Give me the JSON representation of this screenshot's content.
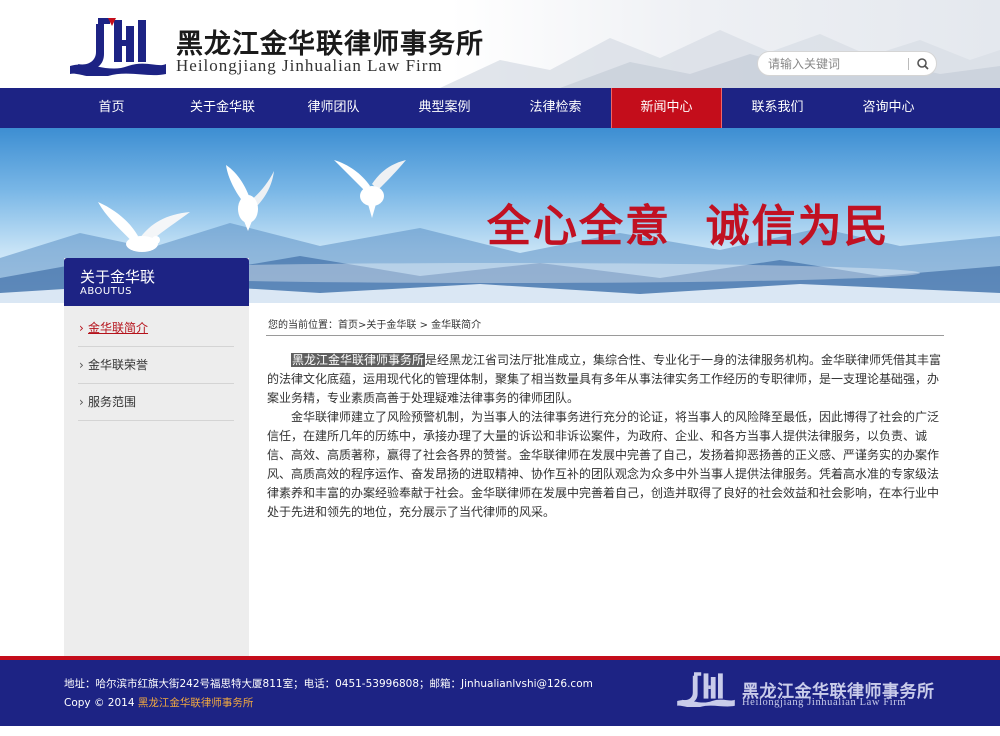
{
  "header": {
    "brand_cn": "黑龙江金华联律师事务所",
    "brand_en": "Heilongjiang Jinhualian Law Firm",
    "search_placeholder": "请输入关键词"
  },
  "nav": {
    "items": [
      "首页",
      "关于金华联",
      "律师团队",
      "典型案例",
      "法律检索",
      "新闻中心",
      "联系我们",
      "咨询中心"
    ],
    "active": "新闻中心"
  },
  "banner": {
    "slogan": "全心全意  诚信为民"
  },
  "sidebar": {
    "title_cn": "关于金华联",
    "title_en": "ABOUTUS",
    "items": [
      "金华联简介",
      "金华联荣誉",
      "服务范围"
    ],
    "active": "金华联简介"
  },
  "breadcrumb": {
    "prefix": "您的当前位置：",
    "items": [
      "首页",
      "关于金华联",
      "金华联简介"
    ],
    "sep1": ">",
    "sep2": " > "
  },
  "article": {
    "highlight": "黑龙江金华联律师事务所",
    "p1_rest": "是经黑龙江省司法厅批准成立，集综合性、专业化于一身的法律服务机构。金华联律师凭借其丰富的法律文化底蕴，运用现代化的管理体制，聚集了相当数量具有多年从事法律实务工作经历的专职律师，是一支理论基础强，办案业务精，专业素质高善于处理疑难法律事务的律师团队。",
    "p2": "金华联律师建立了风险预警机制，为当事人的法律事务进行充分的论证，将当事人的风险降至最低，因此博得了社会的广泛信任，在建所几年的历练中，承接办理了大量的诉讼和非诉讼案件，为政府、企业、和各方当事人提供法律服务，以负责、诚信、高效、高质著称，赢得了社会各界的赞誉。金华联律师在发展中完善了自己，发扬着抑恶扬善的正义感、严谨务实的办案作风、高质高效的程序运作、奋发昂扬的进取精神、协作互补的团队观念为众多中外当事人提供法律服务。凭着高水准的专家级法律素养和丰富的办案经验奉献于社会。金华联律师在发展中完善着自己，创造并取得了良好的社会效益和社会影响，在本行业中处于先进和领先的地位，充分展示了当代律师的风采。"
  },
  "footer": {
    "address": "地址：哈尔滨市红旗大街242号福思特大厦811室；电话：0451-53996808；邮箱：Jinhualianlvshi@126.com",
    "copyright_prefix": "Copy © 2014 ",
    "copyright_link": "黑龙江金华联律师事务所",
    "brand_cn": "黑龙江金华联律师事务所",
    "brand_en": "Heilongjiang Jinhualian Law Firm"
  },
  "colors": {
    "navy": "#1d2384",
    "red": "#c40d1b",
    "slogan_red": "#c11122",
    "footer_link": "#f2a940"
  },
  "icons": [
    "firm-logo-icon",
    "search-icon",
    "dove-icon",
    "chevron-right-icon"
  ]
}
